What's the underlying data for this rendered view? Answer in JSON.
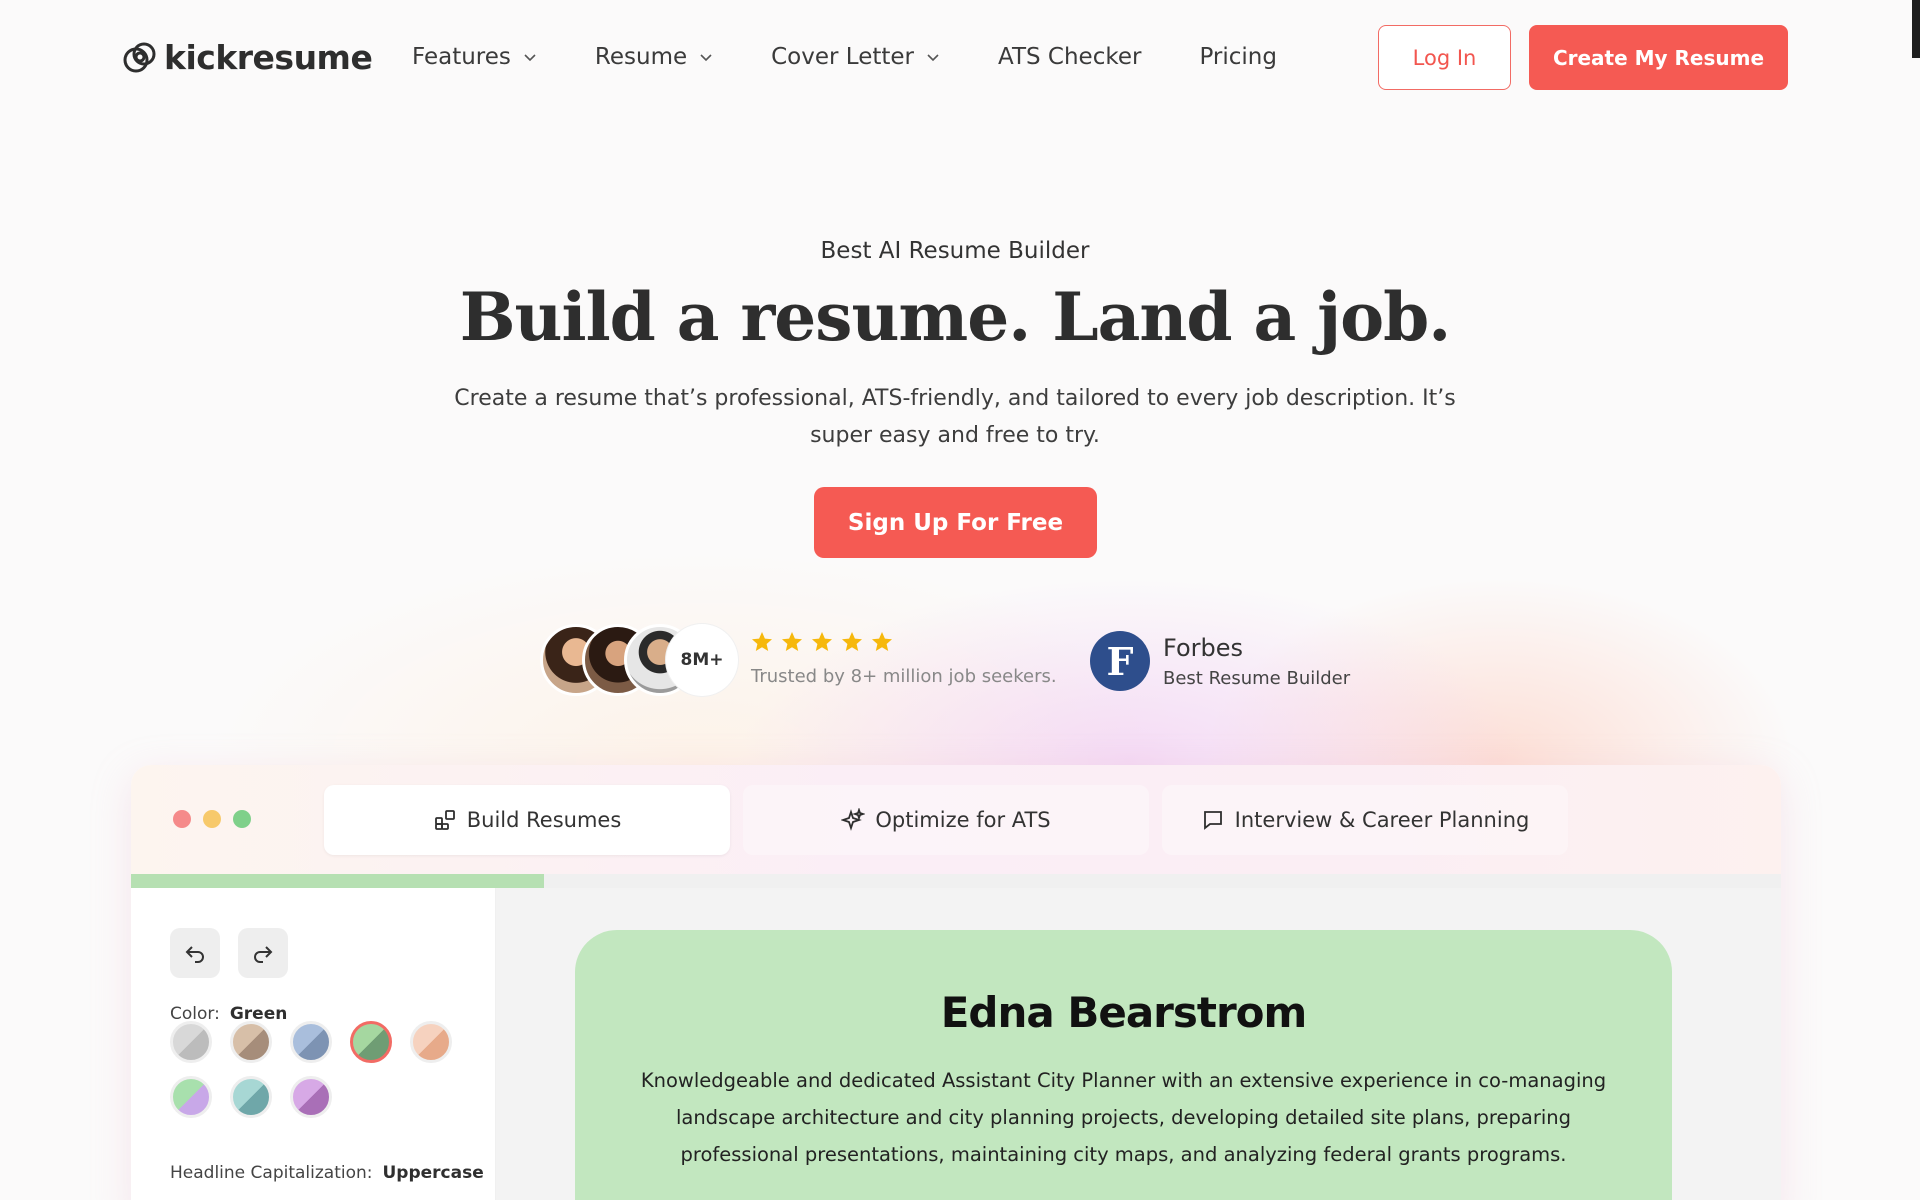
{
  "brand": {
    "name": "kickresume"
  },
  "nav": {
    "items": [
      {
        "label": "Features",
        "has_dropdown": true
      },
      {
        "label": "Resume",
        "has_dropdown": true
      },
      {
        "label": "Cover Letter",
        "has_dropdown": true
      },
      {
        "label": "ATS Checker",
        "has_dropdown": false
      },
      {
        "label": "Pricing",
        "has_dropdown": false
      }
    ],
    "login_label": "Log In",
    "create_label": "Create My Resume"
  },
  "hero": {
    "eyebrow": "Best AI Resume Builder",
    "title": "Build a resume. Land a job.",
    "subtitle": "Create a resume that’s professional, ATS-friendly, and tailored to every job description. It’s super easy and free to try.",
    "cta_label": "Sign Up For Free"
  },
  "trust": {
    "user_count": "8M+",
    "rating_stars": 5,
    "trusted_text": "Trusted by 8+ million job seekers.",
    "forbes_letter": "F",
    "forbes_name": "Forbes",
    "forbes_sub": "Best Resume Builder"
  },
  "preview": {
    "tabs": [
      {
        "label": "Build Resumes",
        "icon": "blocks-icon",
        "active": true
      },
      {
        "label": "Optimize for ATS",
        "icon": "sparkle-icon",
        "active": false
      },
      {
        "label": "Interview & Career Planning",
        "icon": "chat-icon",
        "active": false
      }
    ],
    "progress_fraction": 0.25,
    "sidebar": {
      "color_label": "Color:",
      "color_value": "Green",
      "swatches": [
        {
          "name": "gray",
          "a": "#d8d8d8",
          "b": "#bcbcbc",
          "selected": false
        },
        {
          "name": "tan",
          "a": "#d7bfa8",
          "b": "#a68d7a",
          "selected": false
        },
        {
          "name": "blue",
          "a": "#a9bedc",
          "b": "#7d93b3",
          "selected": false
        },
        {
          "name": "green",
          "a": "#a5d7a0",
          "b": "#6f9d74",
          "selected": true
        },
        {
          "name": "peach",
          "a": "#f6d2bf",
          "b": "#e7aa8a",
          "selected": false
        },
        {
          "name": "lime-lavender",
          "a": "#a8e0ad",
          "b": "#c8a8e8",
          "selected": false
        },
        {
          "name": "teal",
          "a": "#a7d7d4",
          "b": "#6fa7a9",
          "selected": false
        },
        {
          "name": "purple",
          "a": "#d7a9e6",
          "b": "#a96fb7",
          "selected": false
        }
      ],
      "capitalization_label": "Headline Capitalization:",
      "capitalization_value": "Uppercase"
    },
    "resume": {
      "name": "Edna Bearstrom",
      "summary": "Knowledgeable and dedicated Assistant City Planner with an extensive experience in co-managing landscape architecture and city planning projects, developing  detailed site plans, preparing professional presentations, maintaining city maps, and analyzing federal grants programs."
    }
  },
  "colors": {
    "accent": "#f55a53",
    "resume_green": "#c2e7bf",
    "progress_green": "#b6e0b2",
    "forbes_blue": "#2e4e8c",
    "star_gold": "#f6b80c",
    "window_dots": [
      "#f58a8a",
      "#f7c96b",
      "#7fd08a"
    ]
  }
}
